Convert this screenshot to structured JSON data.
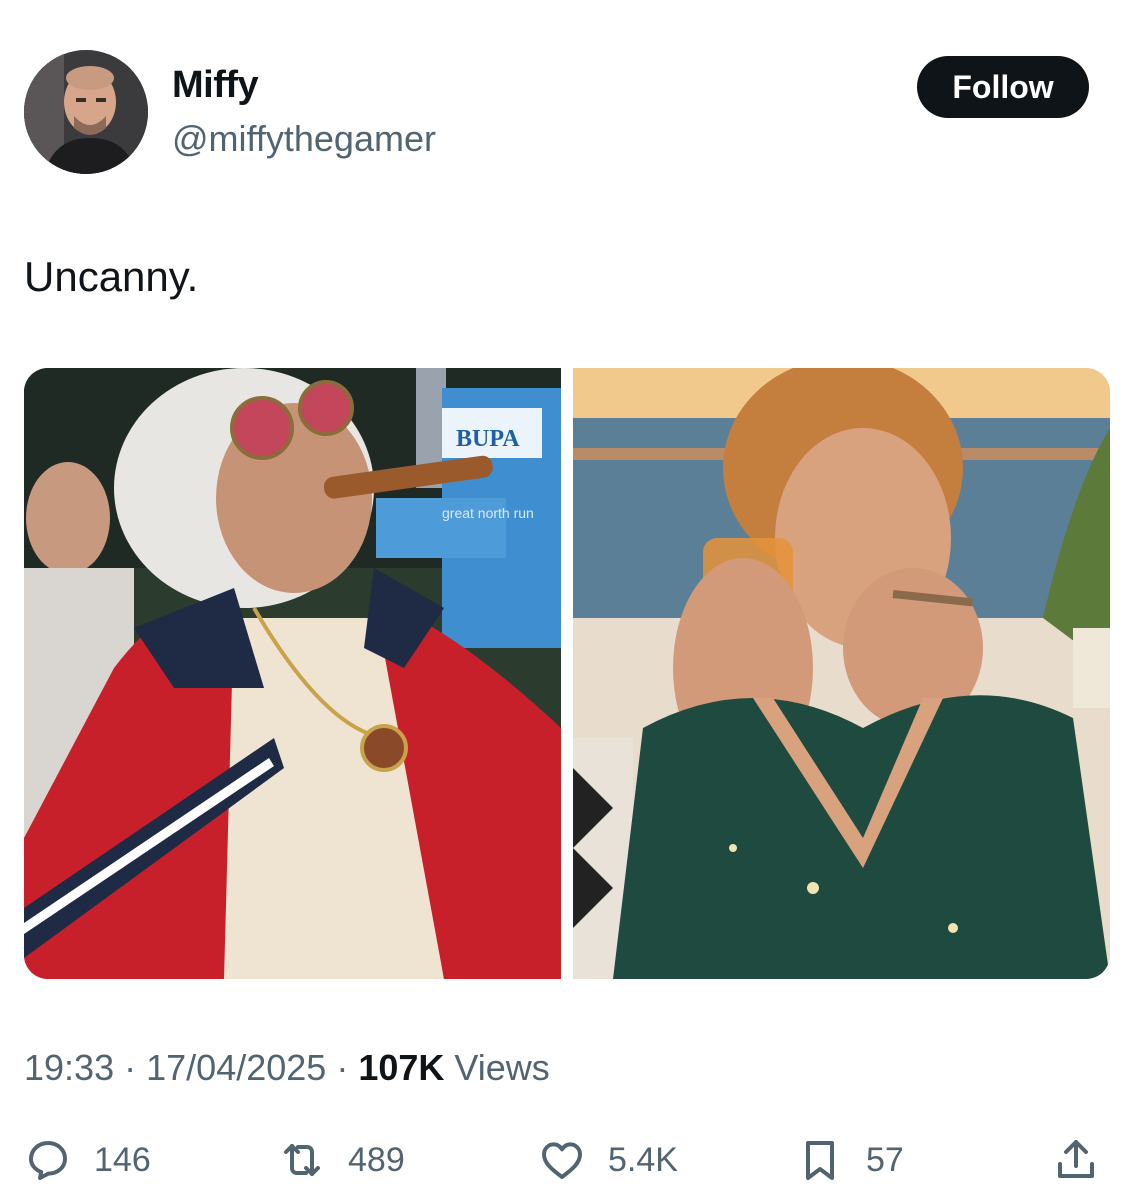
{
  "author": {
    "display_name": "Miffy",
    "handle": "@miffythegamer"
  },
  "follow_label": "Follow",
  "tweet": {
    "text": "Uncanny."
  },
  "media": {
    "left": {
      "banner_text_1": "BUPA",
      "banner_text_2": "great north run",
      "jacket_color": "#c8202a"
    },
    "right": {
      "sky_color": "#f2c98d",
      "sea_color": "#5c7f98",
      "dress_color": "#1e4a3f"
    }
  },
  "meta": {
    "time": "19:33",
    "separator": "·",
    "date": "17/04/2025",
    "views_count": "107K",
    "views_label": "Views"
  },
  "actions": {
    "replies": "146",
    "reposts": "489",
    "likes": "5.4K",
    "bookmarks": "57"
  },
  "icons": {
    "reply": "reply-icon",
    "repost": "repost-icon",
    "like": "heart-icon",
    "bookmark": "bookmark-icon",
    "share": "share-icon"
  }
}
